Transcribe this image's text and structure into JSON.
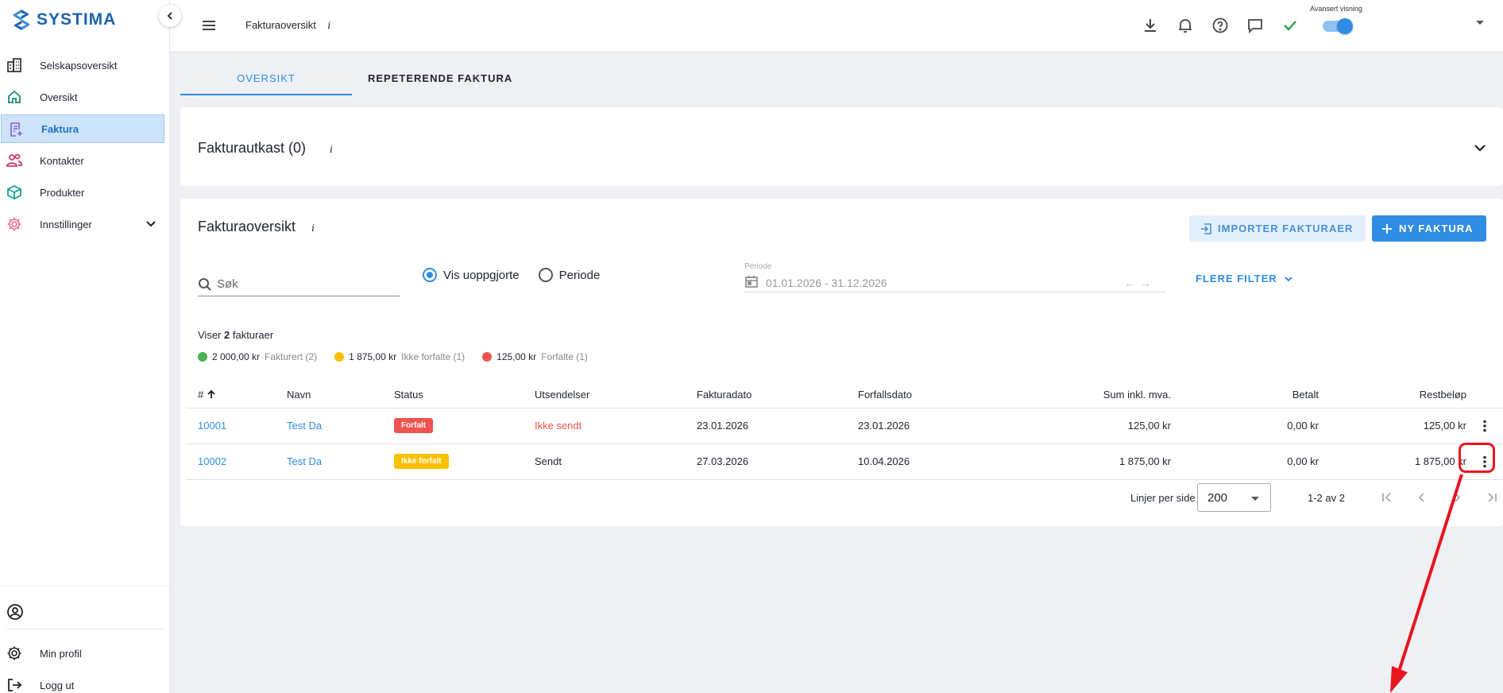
{
  "brand": {
    "name": "SYSTIMA"
  },
  "sidebar": {
    "items": [
      {
        "label": "Selskapsoversikt"
      },
      {
        "label": "Oversikt"
      },
      {
        "label": "Faktura"
      },
      {
        "label": "Kontakter"
      },
      {
        "label": "Produkter"
      },
      {
        "label": "Innstillinger"
      }
    ],
    "bottom": [
      {
        "label": "Min profil"
      },
      {
        "label": "Logg ut"
      }
    ]
  },
  "topbar": {
    "title": "Fakturaoversikt",
    "info": "i",
    "toggle_label": "Avansert visning",
    "toggle_on": true
  },
  "tabs": [
    {
      "label": "OVERSIKT",
      "active": true
    },
    {
      "label": "REPETERENDE FAKTURA",
      "active": false
    }
  ],
  "drafts": {
    "title": "Fakturautkast (0)",
    "info": "i"
  },
  "overview": {
    "title": "Fakturaoversikt",
    "info": "i",
    "import_button": "IMPORTER FAKTURAER",
    "new_button": "NY FAKTURA",
    "search_placeholder": "Søk",
    "radio_unsettled": "Vis uoppgjorte",
    "radio_period": "Periode",
    "period_label": "Periode",
    "period_value": "01.01.2026 - 31.12.2026",
    "more_filters": "FLERE FILTER",
    "count_prefix": "Viser ",
    "count_number": "2",
    "count_suffix": " fakturaer",
    "legend": [
      {
        "amount": "2 000,00 kr",
        "label": "Fakturert (2)",
        "color": "#4caf50"
      },
      {
        "amount": "1 875,00 kr",
        "label": "Ikke forfalte (1)",
        "color": "#f9c000"
      },
      {
        "amount": "125,00 kr",
        "label": "Forfalte (1)",
        "color": "#ef5350"
      }
    ],
    "columns": [
      "#",
      "Navn",
      "Status",
      "Utsendelser",
      "Fakturadato",
      "Forfallsdato",
      "Sum inkl. mva.",
      "Betalt",
      "Restbeløp"
    ],
    "rows": [
      {
        "number": "10001",
        "name": "Test Da",
        "status": "Forfalt",
        "sending": "Ikke sendt",
        "invoice_date": "23.01.2026",
        "due_date": "23.01.2026",
        "sum": "125,00 kr",
        "paid": "0,00 kr",
        "remaining": "125,00 kr"
      },
      {
        "number": "10002",
        "name": "Test Da",
        "status": "Ikke forfalt",
        "sending": "Sendt",
        "invoice_date": "27.03.2026",
        "due_date": "10.04.2026",
        "sum": "1 875,00 kr",
        "paid": "0,00 kr",
        "remaining": "1 875,00 kr"
      }
    ],
    "pager": {
      "rows_label": "Linjer per side",
      "rows_value": "200",
      "range": "1-2 av 2"
    }
  },
  "colors": {
    "accent": "#2f8de4",
    "brand": "#1d62b3",
    "overdue": "#ef5350",
    "not_due": "#f9c000",
    "annotation": "#e8141e"
  }
}
